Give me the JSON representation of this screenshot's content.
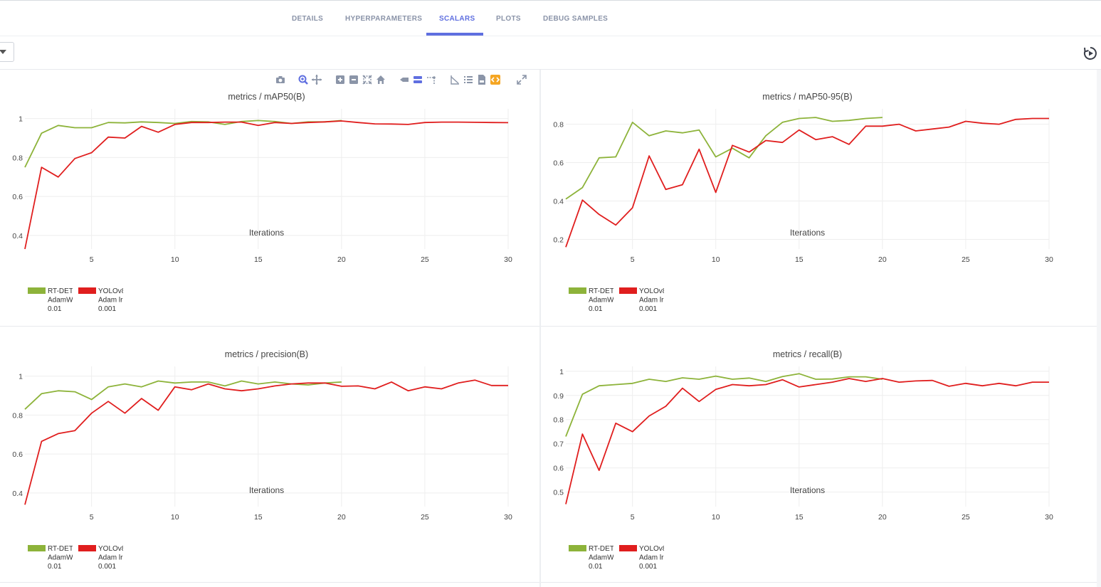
{
  "tabs": [
    {
      "label": "DETAILS",
      "active": false
    },
    {
      "label": "HYPERPARAMETERS",
      "active": false
    },
    {
      "label": "SCALARS",
      "active": true
    },
    {
      "label": "PLOTS",
      "active": false
    },
    {
      "label": "DEBUG SAMPLES",
      "active": false
    }
  ],
  "colors": {
    "accent": "#5f6fe0",
    "series_green": "#8db33a",
    "series_red": "#e01e1e"
  },
  "modebar_icons": [
    "camera-icon",
    "zoom-icon",
    "pan-icon",
    "zoom-in-icon",
    "zoom-out-icon",
    "autoscale-icon",
    "reset-axes-icon",
    "hover-closest-icon",
    "hover-compare-icon",
    "spike-lines-icon",
    "log-scale-icon",
    "list-icon",
    "download-csv-icon",
    "embed-json-icon",
    "maximize-icon"
  ],
  "chart_data": [
    {
      "type": "line",
      "title": "metrics / mAP50(B)",
      "xlabel": "Iterations",
      "xlim": [
        1,
        30
      ],
      "ylim": [
        0.33,
        1.05
      ],
      "xticks": [
        5,
        10,
        15,
        20,
        25,
        30
      ],
      "yticks": [
        0.4,
        0.6,
        0.8,
        1
      ],
      "ytick_labels": [
        "0.4",
        "0.6",
        "0.8",
        "1"
      ],
      "grid": true,
      "legend_position": "bottom-left",
      "series": [
        {
          "name": "RT-DETR AdamW lr 0.01",
          "legend_lines": [
            "RT-DETR",
            "AdamW lr",
            "0.01"
          ],
          "color": "#8db33a",
          "x": [
            1,
            2,
            3,
            4,
            5,
            6,
            7,
            8,
            9,
            10,
            11,
            12,
            13,
            14,
            15,
            16,
            17,
            18,
            19,
            20
          ],
          "y": [
            0.75,
            0.925,
            0.965,
            0.953,
            0.953,
            0.98,
            0.978,
            0.983,
            0.98,
            0.975,
            0.985,
            0.983,
            0.97,
            0.985,
            0.99,
            0.985,
            0.975,
            0.983,
            0.983,
            0.99
          ]
        },
        {
          "name": "YOLOv8 Adam lr 0.001",
          "legend_lines": [
            "YOLOv8",
            "Adam lr",
            "0.001"
          ],
          "color": "#e01e1e",
          "x": [
            1,
            2,
            3,
            4,
            5,
            6,
            7,
            8,
            9,
            10,
            11,
            12,
            13,
            14,
            15,
            16,
            17,
            18,
            19,
            20,
            21,
            22,
            23,
            24,
            25,
            26,
            27,
            28,
            29,
            30
          ],
          "y": [
            0.33,
            0.75,
            0.7,
            0.795,
            0.825,
            0.905,
            0.9,
            0.96,
            0.93,
            0.97,
            0.98,
            0.98,
            0.982,
            0.982,
            0.965,
            0.98,
            0.975,
            0.98,
            0.983,
            0.988,
            0.98,
            0.973,
            0.972,
            0.97,
            0.98,
            0.982,
            0.982,
            0.981,
            0.98,
            0.979
          ]
        }
      ]
    },
    {
      "type": "line",
      "title": "metrics / mAP50-95(B)",
      "xlabel": "Iterations",
      "xlim": [
        1,
        30
      ],
      "ylim": [
        0.15,
        0.88
      ],
      "xticks": [
        5,
        10,
        15,
        20,
        25,
        30
      ],
      "yticks": [
        0.2,
        0.4,
        0.6,
        0.8
      ],
      "ytick_labels": [
        "0.2",
        "0.4",
        "0.6",
        "0.8"
      ],
      "grid": true,
      "legend_position": "bottom-left",
      "series": [
        {
          "name": "RT-DETR AdamW lr 0.01",
          "legend_lines": [
            "RT-DETR",
            "AdamW lr",
            "0.01"
          ],
          "color": "#8db33a",
          "x": [
            1,
            2,
            3,
            4,
            5,
            6,
            7,
            8,
            9,
            10,
            11,
            12,
            13,
            14,
            15,
            16,
            17,
            18,
            19,
            20
          ],
          "y": [
            0.41,
            0.47,
            0.625,
            0.63,
            0.81,
            0.74,
            0.765,
            0.755,
            0.77,
            0.63,
            0.675,
            0.625,
            0.74,
            0.81,
            0.83,
            0.835,
            0.815,
            0.82,
            0.83,
            0.835
          ]
        },
        {
          "name": "YOLOv8 Adam lr 0.001",
          "legend_lines": [
            "YOLOv8",
            "Adam lr",
            "0.001"
          ],
          "color": "#e01e1e",
          "x": [
            1,
            2,
            3,
            4,
            5,
            6,
            7,
            8,
            9,
            10,
            11,
            12,
            13,
            14,
            15,
            16,
            17,
            18,
            19,
            20,
            21,
            22,
            23,
            24,
            25,
            26,
            27,
            28,
            29,
            30
          ],
          "y": [
            0.16,
            0.405,
            0.33,
            0.275,
            0.365,
            0.635,
            0.46,
            0.485,
            0.67,
            0.445,
            0.69,
            0.655,
            0.715,
            0.705,
            0.77,
            0.72,
            0.735,
            0.695,
            0.79,
            0.79,
            0.8,
            0.765,
            0.775,
            0.785,
            0.815,
            0.805,
            0.8,
            0.825,
            0.83,
            0.83
          ]
        }
      ]
    },
    {
      "type": "line",
      "title": "metrics / precision(B)",
      "xlabel": "Iterations",
      "xlim": [
        1,
        30
      ],
      "ylim": [
        0.33,
        1.05
      ],
      "xticks": [
        5,
        10,
        15,
        20,
        25,
        30
      ],
      "yticks": [
        0.4,
        0.6,
        0.8,
        1
      ],
      "ytick_labels": [
        "0.4",
        "0.6",
        "0.8",
        "1"
      ],
      "grid": true,
      "legend_position": "bottom-left",
      "series": [
        {
          "name": "RT-DETR AdamW lr 0.01",
          "legend_lines": [
            "RT-DETR",
            "AdamW lr",
            "0.01"
          ],
          "color": "#8db33a",
          "x": [
            1,
            2,
            3,
            4,
            5,
            6,
            7,
            8,
            9,
            10,
            11,
            12,
            13,
            14,
            15,
            16,
            17,
            18,
            19,
            20
          ],
          "y": [
            0.83,
            0.91,
            0.925,
            0.92,
            0.88,
            0.945,
            0.96,
            0.945,
            0.975,
            0.965,
            0.97,
            0.97,
            0.95,
            0.975,
            0.96,
            0.97,
            0.96,
            0.955,
            0.965,
            0.97
          ]
        },
        {
          "name": "YOLOv8 Adam lr 0.001",
          "legend_lines": [
            "YOLOv8",
            "Adam lr",
            "0.001"
          ],
          "color": "#e01e1e",
          "x": [
            1,
            2,
            3,
            4,
            5,
            6,
            7,
            8,
            9,
            10,
            11,
            12,
            13,
            14,
            15,
            16,
            17,
            18,
            19,
            20,
            21,
            22,
            23,
            24,
            25,
            26,
            27,
            28,
            29,
            30
          ],
          "y": [
            0.34,
            0.665,
            0.705,
            0.72,
            0.81,
            0.87,
            0.81,
            0.885,
            0.825,
            0.945,
            0.93,
            0.96,
            0.935,
            0.925,
            0.935,
            0.95,
            0.96,
            0.965,
            0.965,
            0.948,
            0.95,
            0.935,
            0.97,
            0.925,
            0.945,
            0.935,
            0.965,
            0.98,
            0.952,
            0.952
          ]
        }
      ]
    },
    {
      "type": "line",
      "title": "metrics / recall(B)",
      "xlabel": "Iterations",
      "xlim": [
        1,
        30
      ],
      "ylim": [
        0.44,
        1.02
      ],
      "xticks": [
        5,
        10,
        15,
        20,
        25,
        30
      ],
      "yticks": [
        0.5,
        0.6,
        0.7,
        0.8,
        0.9,
        1
      ],
      "ytick_labels": [
        "0.5",
        "0.6",
        "0.7",
        "0.8",
        "0.9",
        "1"
      ],
      "grid": true,
      "legend_position": "bottom-left",
      "series": [
        {
          "name": "RT-DETR AdamW lr 0.01",
          "legend_lines": [
            "RT-DETR",
            "AdamW lr",
            "0.01"
          ],
          "color": "#8db33a",
          "x": [
            1,
            2,
            3,
            4,
            5,
            6,
            7,
            8,
            9,
            10,
            11,
            12,
            13,
            14,
            15,
            16,
            17,
            18,
            19,
            20
          ],
          "y": [
            0.73,
            0.905,
            0.94,
            0.945,
            0.95,
            0.967,
            0.958,
            0.973,
            0.967,
            0.98,
            0.967,
            0.972,
            0.958,
            0.978,
            0.99,
            0.967,
            0.968,
            0.977,
            0.977,
            0.967
          ]
        },
        {
          "name": "YOLOv8 Adam lr 0.001",
          "legend_lines": [
            "YOLOv8",
            "Adam lr",
            "0.001"
          ],
          "color": "#e01e1e",
          "x": [
            1,
            2,
            3,
            4,
            5,
            6,
            7,
            8,
            9,
            10,
            11,
            12,
            13,
            14,
            15,
            16,
            17,
            18,
            19,
            20,
            21,
            22,
            23,
            24,
            25,
            26,
            27,
            28,
            29,
            30
          ],
          "y": [
            0.45,
            0.74,
            0.59,
            0.785,
            0.75,
            0.815,
            0.855,
            0.93,
            0.875,
            0.925,
            0.945,
            0.94,
            0.945,
            0.965,
            0.935,
            0.945,
            0.955,
            0.97,
            0.958,
            0.97,
            0.955,
            0.96,
            0.962,
            0.938,
            0.95,
            0.94,
            0.95,
            0.94,
            0.955,
            0.955
          ]
        }
      ]
    }
  ]
}
